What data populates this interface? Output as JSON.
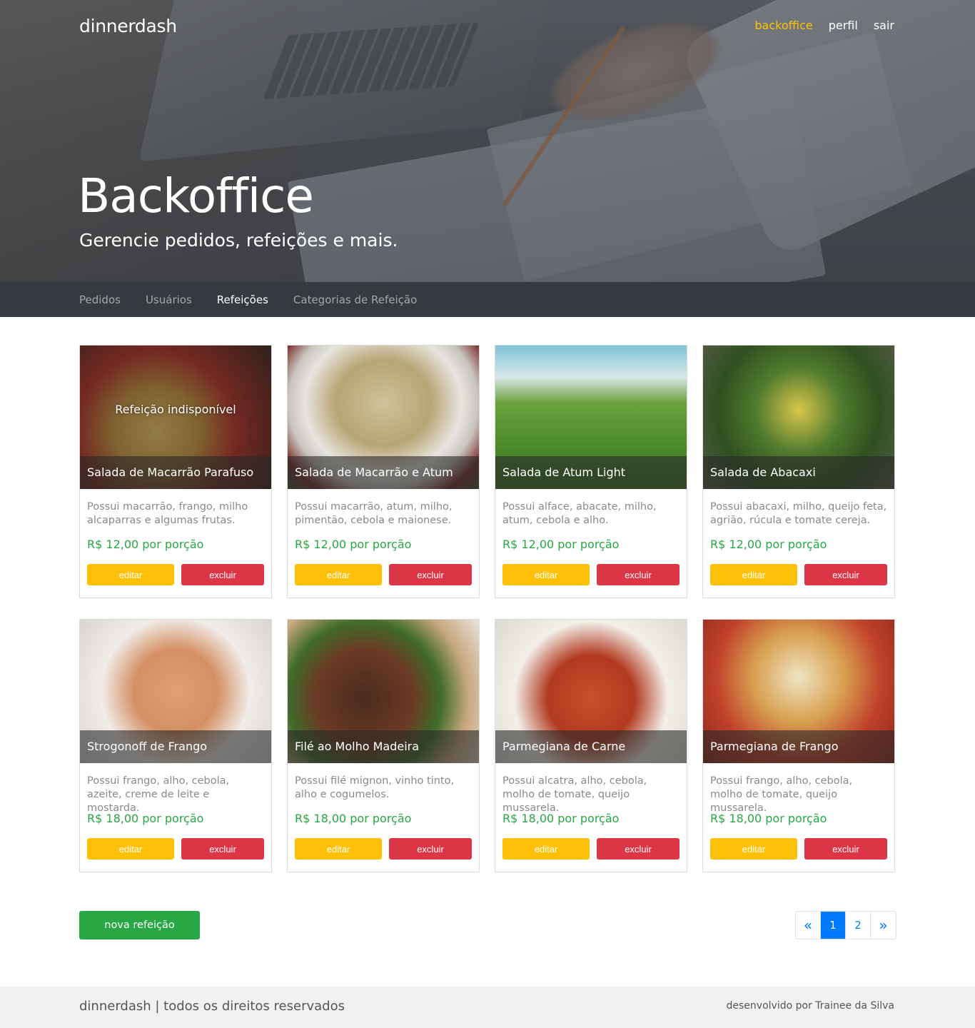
{
  "header": {
    "brand": "dinnerdash",
    "nav": [
      {
        "label": "backoffice",
        "active": true
      },
      {
        "label": "perfil",
        "active": false
      },
      {
        "label": "sair",
        "active": false
      }
    ],
    "title": "Backoffice",
    "subtitle": "Gerencie pedidos, refeições e mais."
  },
  "subnav": [
    {
      "label": "Pedidos",
      "active": false
    },
    {
      "label": "Usuários",
      "active": false
    },
    {
      "label": "Refeições",
      "active": true
    },
    {
      "label": "Categorias de Refeição",
      "active": false
    }
  ],
  "meals": [
    {
      "name": "Salada de Macarrão Parafuso",
      "description": "Possui macarrão, frango, milho alcaparras e algumas frutas.",
      "price": "R$ 12,00 por porção",
      "unavailable_label": "Refeição indisponível",
      "image": "pasta-salad-image"
    },
    {
      "name": "Salada de Macarrão e Atum",
      "description": "Possui macarrão, atum, milho, pimentão, cebola e maionese.",
      "price": "R$ 12,00 por porção",
      "unavailable_label": "",
      "image": "tuna-pasta-image"
    },
    {
      "name": "Salada de Atum Light",
      "description": "Possui alface, abacate, milho, atum, cebola e alho.",
      "price": "R$ 12,00 por porção",
      "unavailable_label": "",
      "image": "tuna-salad-image"
    },
    {
      "name": "Salada de Abacaxi",
      "description": "Possui abacaxi, milho, queijo feta, agrião, rúcula e tomate cereja.",
      "price": "R$ 12,00 por porção",
      "unavailable_label": "",
      "image": "pineapple-salad-image"
    },
    {
      "name": "Strogonoff de Frango",
      "description": "Possui frango, alho, cebola, azeite, creme de leite e mostarda.",
      "price": "R$ 18,00 por porção",
      "unavailable_label": "",
      "image": "stroganoff-image"
    },
    {
      "name": "Filé ao Molho Madeira",
      "description": "Possui filé mignon, vinho tinto, alho e cogumelos.",
      "price": "R$ 18,00 por porção",
      "unavailable_label": "",
      "image": "steak-image"
    },
    {
      "name": "Parmegiana de Carne",
      "description": "Possui alcatra, alho, cebola, molho de tomate, queijo mussarela.",
      "price": "R$ 18,00 por porção",
      "unavailable_label": "",
      "image": "beef-parmigiana-image"
    },
    {
      "name": "Parmegiana de Frango",
      "description": "Possui frango, alho, cebola, molho de tomate, queijo mussarela.",
      "price": "R$ 18,00 por porção",
      "unavailable_label": "",
      "image": "chicken-parmigiana-image"
    }
  ],
  "actions": {
    "edit_label": "editar",
    "delete_label": "excluir",
    "new_label": "nova refeição"
  },
  "pagination": {
    "prev": "«",
    "pages": [
      "1",
      "2"
    ],
    "current": "1",
    "next": "»"
  },
  "footer": {
    "left": "dinnerdash | todos os direitos reservados",
    "right": "desenvolvido por Trainee da Silva"
  },
  "colors": {
    "accent": "#ffc107",
    "danger": "#dc3545",
    "success": "#28a745",
    "primary": "#007bff",
    "subnav_bg": "#343a40"
  }
}
